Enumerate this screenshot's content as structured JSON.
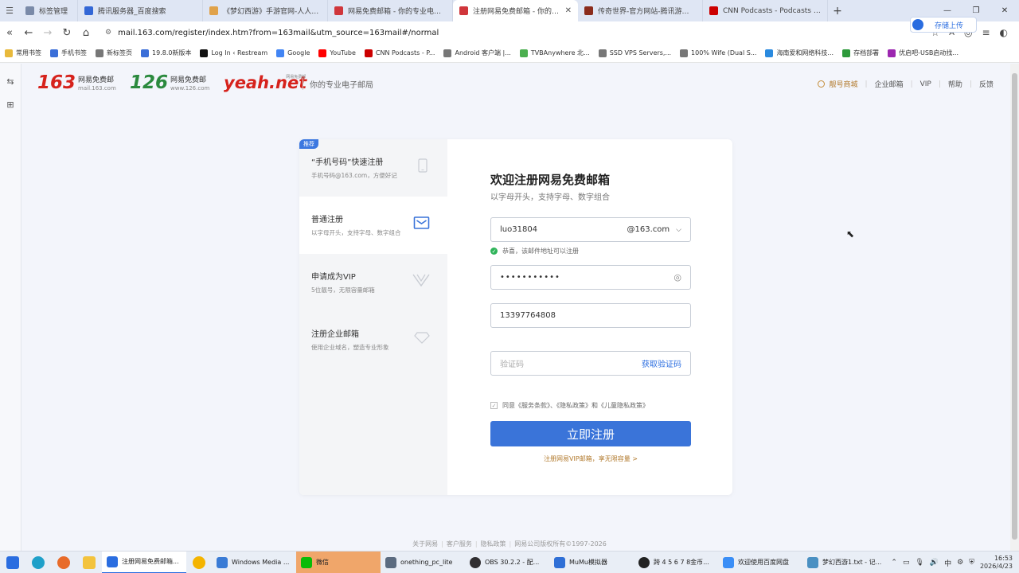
{
  "browser": {
    "tabs": [
      {
        "title": "标签管理",
        "color": "#7a8aa8"
      },
      {
        "title": "腾讯服务器_百度搜索",
        "color": "#3367d6"
      },
      {
        "title": "《梦幻西游》手游官网-人人都玩",
        "color": "#e0a24a"
      },
      {
        "title": "网易免费邮箱 - 你的专业电子邮局",
        "color": "#d0363b"
      },
      {
        "title": "注册网易免费邮箱 - 你的专业电",
        "color": "#d0363b",
        "active": true
      },
      {
        "title": "传奇世界-官方网站-腾讯游戏-经典",
        "color": "#8b2c1c"
      },
      {
        "title": "CNN Podcasts - Podcasts and Ne",
        "color": "#cc0000"
      }
    ],
    "new_tab": "+",
    "cloud_button": "存储上传",
    "url": "mail.163.com/register/index.htm?from=163mail&utm_source=163mail#/normal",
    "bookmarks": [
      {
        "label": "常用书签",
        "color": "#e8b93b"
      },
      {
        "label": "手机书签",
        "color": "#3b6fd8"
      },
      {
        "label": "新标签页",
        "color": "#777777"
      },
      {
        "label": "19.8.0新版本",
        "color": "#3b6fd8"
      },
      {
        "label": "Log In ‹ Restream",
        "color": "#111111"
      },
      {
        "label": "Google",
        "color": "#4285f4"
      },
      {
        "label": "YouTube",
        "color": "#ff0000"
      },
      {
        "label": "CNN Podcasts - P...",
        "color": "#cc0000"
      },
      {
        "label": "Android 客户端 |...",
        "color": "#777777"
      },
      {
        "label": "TVBAnywhere 北...",
        "color": "#4caf50"
      },
      {
        "label": "SSD VPS Servers,...",
        "color": "#777777"
      },
      {
        "label": "100% Wife (Dual S...",
        "color": "#777777"
      },
      {
        "label": "海南爱和网络科技...",
        "color": "#2a8adf"
      },
      {
        "label": "存档部署",
        "color": "#2e9a3b"
      },
      {
        "label": "优启吧-USB启动找...",
        "color": "#9c27b0"
      }
    ]
  },
  "header": {
    "logo163": {
      "num": "163",
      "name": "网易免费邮",
      "domain": "mail.163.com"
    },
    "logo126": {
      "num": "126",
      "name": "网易免费邮",
      "domain": "www.126.com"
    },
    "logoYeah": {
      "text": "yeah.net",
      "tag": "网易免费邮"
    },
    "slogan": "你的专业电子邮局",
    "links": [
      "靓号商城",
      "企业邮箱",
      "VIP",
      "帮助",
      "反馈"
    ]
  },
  "sidebar": {
    "badge": "推荐",
    "items": [
      {
        "title": "“手机号码”快速注册",
        "desc": "手机号码@163.com，方便好记"
      },
      {
        "title": "普通注册",
        "desc": "以字母开头，支持字母、数字组合"
      },
      {
        "title": "申请成为VIP",
        "desc": "5位靓号，无限容量邮箱"
      },
      {
        "title": "注册企业邮箱",
        "desc": "使用企业域名，塑造专业形象"
      }
    ]
  },
  "form": {
    "title": "欢迎注册网易免费邮箱",
    "subtitle": "以字母开头，支持字母、数字组合",
    "username": "luo31804",
    "domain": "@163.com",
    "ok_message": "恭喜，该邮件地址可以注册",
    "password_mask": "•••••••••••",
    "phone": "13397764808",
    "captcha_placeholder": "验证码",
    "get_code": "获取验证码",
    "agree": "同意《服务条款》、《隐私政策》和《儿童隐私政策》",
    "submit": "立即注册",
    "vip_link": "注册网易VIP邮箱，享无限容量 >"
  },
  "footer": [
    "关于网易",
    "客户服务",
    "隐私政策",
    "网易公司版权所有©1997-2026"
  ],
  "taskbar": {
    "apps": [
      {
        "label": "注册网易免费邮箱...",
        "color": "#2a6de0",
        "active": true
      },
      {
        "label": "",
        "color": "#f4b400"
      },
      {
        "label": "Windows Media ...",
        "color": "#3a7bd5"
      },
      {
        "label": "微信",
        "color": "#09bb07",
        "wechat": true
      },
      {
        "label": "onething_pc_lite",
        "color": "#5b6b80"
      },
      {
        "label": "OBS 30.2.2 - 配...",
        "color": "#302e31"
      },
      {
        "label": "MuMu模拟器",
        "color": "#2f6fd6"
      },
      {
        "label": "跨 4 5 6 7 8金币...",
        "color": "#222222"
      },
      {
        "label": "欢迎使用百度网盘",
        "color": "#3a8ef6"
      },
      {
        "label": "梦幻西游1.txt - 记...",
        "color": "#4a90c2"
      }
    ],
    "time": "16:53",
    "date": "2026/4/23",
    "ime": "中"
  }
}
